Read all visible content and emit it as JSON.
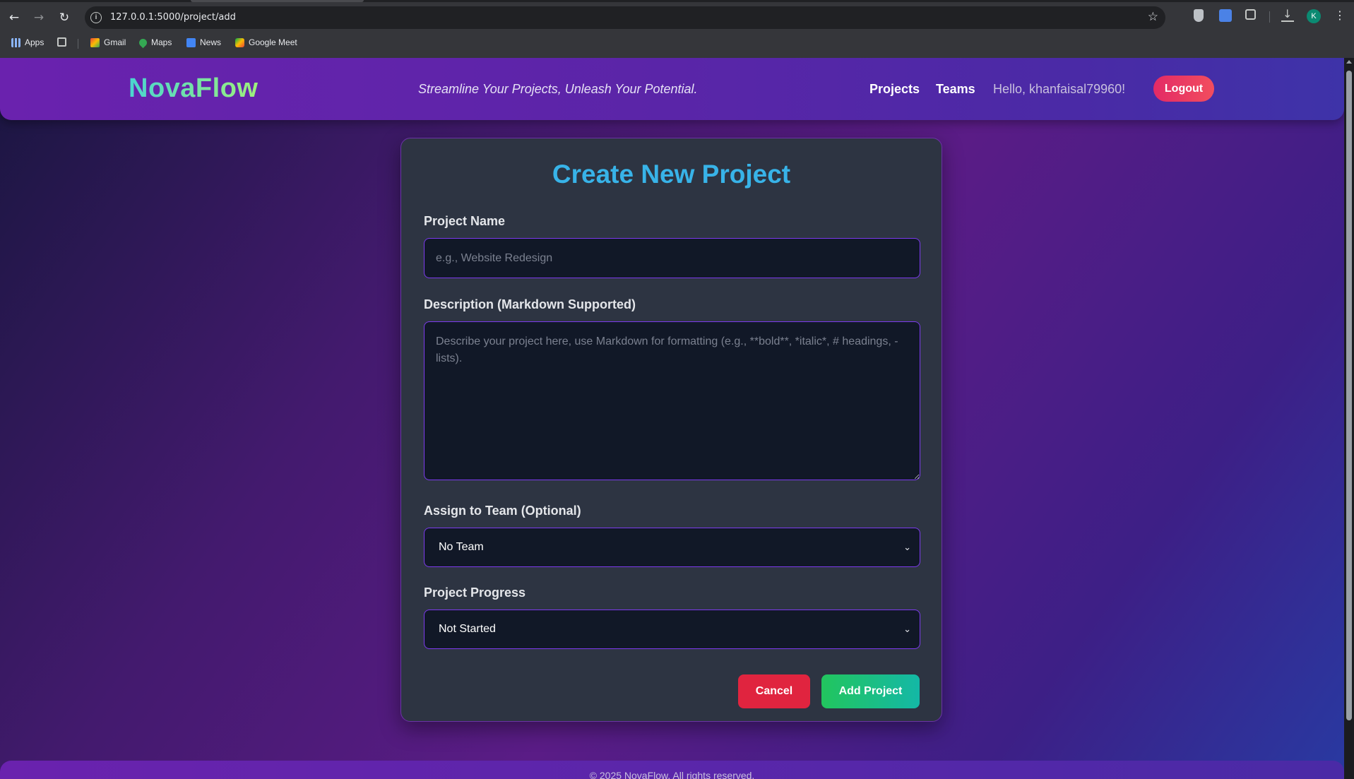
{
  "browser": {
    "url": "127.0.0.1:5000/project/add",
    "profile_initial": "K",
    "bookmarks": [
      {
        "label": "Apps",
        "icon": "apps-grid-icon"
      },
      {
        "label": "",
        "icon": "tab-groups-icon"
      },
      {
        "label": "Gmail",
        "icon": "gmail-icon"
      },
      {
        "label": "Maps",
        "icon": "maps-icon"
      },
      {
        "label": "News",
        "icon": "news-icon"
      },
      {
        "label": "Google Meet",
        "icon": "meet-icon"
      }
    ]
  },
  "navbar": {
    "brand": "NovaFlow",
    "tagline": "Streamline Your Projects, Unleash Your Potential.",
    "links": [
      "Projects",
      "Teams"
    ],
    "greeting": "Hello, khanfaisal79960!",
    "logout_label": "Logout"
  },
  "form": {
    "title": "Create New Project",
    "name_label": "Project Name",
    "name_value": "",
    "name_placeholder": "e.g., Website Redesign",
    "description_label": "Description (Markdown Supported)",
    "description_value": "",
    "description_placeholder": "Describe your project here, use Markdown for formatting (e.g., **bold**, *italic*, # headings, - lists).",
    "team_label": "Assign to Team (Optional)",
    "team_selected": "No Team",
    "progress_label": "Project Progress",
    "progress_selected": "Not Started",
    "cancel_label": "Cancel",
    "submit_label": "Add Project"
  },
  "footer": {
    "text": "© 2025 NovaFlow. All rights reserved."
  },
  "colors": {
    "brand_gradient": [
      "#4ad5d0",
      "#9ef07c"
    ],
    "title": "#38b3e8",
    "cancel": "#e0243f",
    "submit": "#22c55e",
    "logout": "#e32a66",
    "field_border": "#7c3aed",
    "card_bg": "#2d3442"
  }
}
